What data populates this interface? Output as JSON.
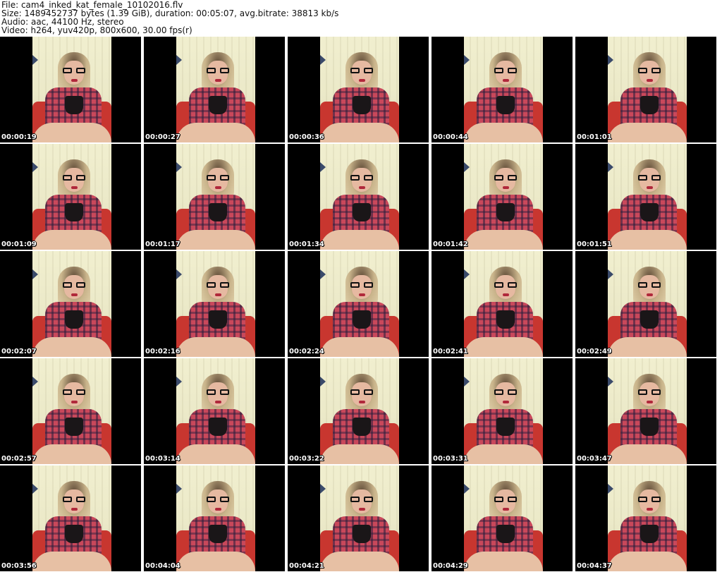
{
  "header": {
    "line1": "File: cam4_inked_kat_female_10102016.flv",
    "line2": "Size: 1489452737 bytes (1.39 GiB), duration: 00:05:07, avg.bitrate: 38813 kb/s",
    "line3": "Audio: aac, 44100 Hz, stereo",
    "line4": "Video: h264, yuv420p, 800x600, 30.00 fps(r)"
  },
  "thumbnails": [
    "00:00:19",
    "00:00:27",
    "00:00:36",
    "00:00:44",
    "00:01:01",
    "00:01:09",
    "00:01:17",
    "00:01:34",
    "00:01:42",
    "00:01:51",
    "00:02:07",
    "00:02:16",
    "00:02:24",
    "00:02:41",
    "00:02:49",
    "00:02:57",
    "00:03:14",
    "00:03:22",
    "00:03:31",
    "00:03:47",
    "00:03:56",
    "00:04:04",
    "00:04:21",
    "00:04:29",
    "00:04:37"
  ]
}
